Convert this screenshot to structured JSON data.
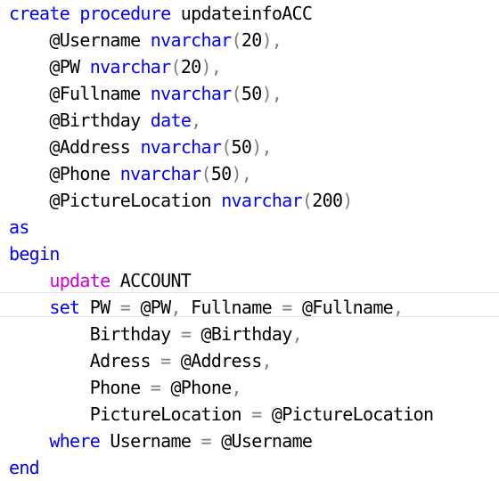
{
  "editor": {
    "language": "T-SQL",
    "colors": {
      "keyword": "#0000ff",
      "dml_keyword": "#d000d0",
      "operator": "#808080",
      "text": "#000000"
    },
    "lines": [
      {
        "indent": 0,
        "tokens": [
          [
            "kw",
            "create"
          ],
          [
            "",
            " "
          ],
          [
            "kw",
            "procedure"
          ],
          [
            "",
            " updateinfoACC"
          ]
        ]
      },
      {
        "indent": 4,
        "tokens": [
          [
            "",
            "@Username "
          ],
          [
            "kw",
            "nvarchar"
          ],
          [
            "op",
            "("
          ],
          [
            "",
            "20"
          ],
          [
            "op",
            "),"
          ]
        ]
      },
      {
        "indent": 4,
        "tokens": [
          [
            "",
            "@PW "
          ],
          [
            "kw",
            "nvarchar"
          ],
          [
            "op",
            "("
          ],
          [
            "",
            "20"
          ],
          [
            "op",
            "),"
          ]
        ]
      },
      {
        "indent": 4,
        "tokens": [
          [
            "",
            "@Fullname "
          ],
          [
            "kw",
            "nvarchar"
          ],
          [
            "op",
            "("
          ],
          [
            "",
            "50"
          ],
          [
            "op",
            "),"
          ]
        ]
      },
      {
        "indent": 4,
        "tokens": [
          [
            "",
            "@Birthday "
          ],
          [
            "kw",
            "date"
          ],
          [
            "op",
            ","
          ]
        ]
      },
      {
        "indent": 4,
        "tokens": [
          [
            "",
            "@Address "
          ],
          [
            "kw",
            "nvarchar"
          ],
          [
            "op",
            "("
          ],
          [
            "",
            "50"
          ],
          [
            "op",
            "),"
          ]
        ]
      },
      {
        "indent": 4,
        "tokens": [
          [
            "",
            "@Phone "
          ],
          [
            "kw",
            "nvarchar"
          ],
          [
            "op",
            "("
          ],
          [
            "",
            "50"
          ],
          [
            "op",
            "),"
          ]
        ]
      },
      {
        "indent": 4,
        "tokens": [
          [
            "",
            "@PictureLocation "
          ],
          [
            "kw",
            "nvarchar"
          ],
          [
            "op",
            "("
          ],
          [
            "",
            "200"
          ],
          [
            "op",
            ")"
          ]
        ]
      },
      {
        "indent": 0,
        "tokens": [
          [
            "kw",
            "as"
          ]
        ]
      },
      {
        "indent": 0,
        "tokens": [
          [
            "kw",
            "begin"
          ]
        ]
      },
      {
        "indent": 4,
        "tokens": [
          [
            "kw2",
            "update"
          ],
          [
            "",
            " ACCOUNT"
          ]
        ]
      },
      {
        "indent": 4,
        "tokens": [
          [
            "kw",
            "set"
          ],
          [
            "",
            " PW "
          ],
          [
            "op",
            "="
          ],
          [
            "",
            " @PW"
          ],
          [
            "op",
            ","
          ],
          [
            "",
            " Fullname "
          ],
          [
            "op",
            "="
          ],
          [
            "",
            " @Fullname"
          ],
          [
            "op",
            ","
          ]
        ]
      },
      {
        "indent": 8,
        "tokens": [
          [
            "",
            "Birthday "
          ],
          [
            "op",
            "="
          ],
          [
            "",
            " @Birthday"
          ],
          [
            "op",
            ","
          ]
        ]
      },
      {
        "indent": 8,
        "tokens": [
          [
            "",
            "Adress "
          ],
          [
            "op",
            "="
          ],
          [
            "",
            " @Address"
          ],
          [
            "op",
            ","
          ]
        ]
      },
      {
        "indent": 8,
        "tokens": [
          [
            "",
            "Phone "
          ],
          [
            "op",
            "="
          ],
          [
            "",
            " @Phone"
          ],
          [
            "op",
            ","
          ]
        ]
      },
      {
        "indent": 8,
        "tokens": [
          [
            "",
            "PictureLocation "
          ],
          [
            "op",
            "="
          ],
          [
            "",
            " @PictureLocation"
          ]
        ]
      },
      {
        "indent": 4,
        "tokens": [
          [
            "kw",
            "where"
          ],
          [
            "",
            " Username "
          ],
          [
            "op",
            "="
          ],
          [
            "",
            " @Username"
          ]
        ]
      },
      {
        "indent": 0,
        "tokens": [
          [
            "kw",
            "end"
          ]
        ]
      }
    ],
    "current_line": 12
  }
}
